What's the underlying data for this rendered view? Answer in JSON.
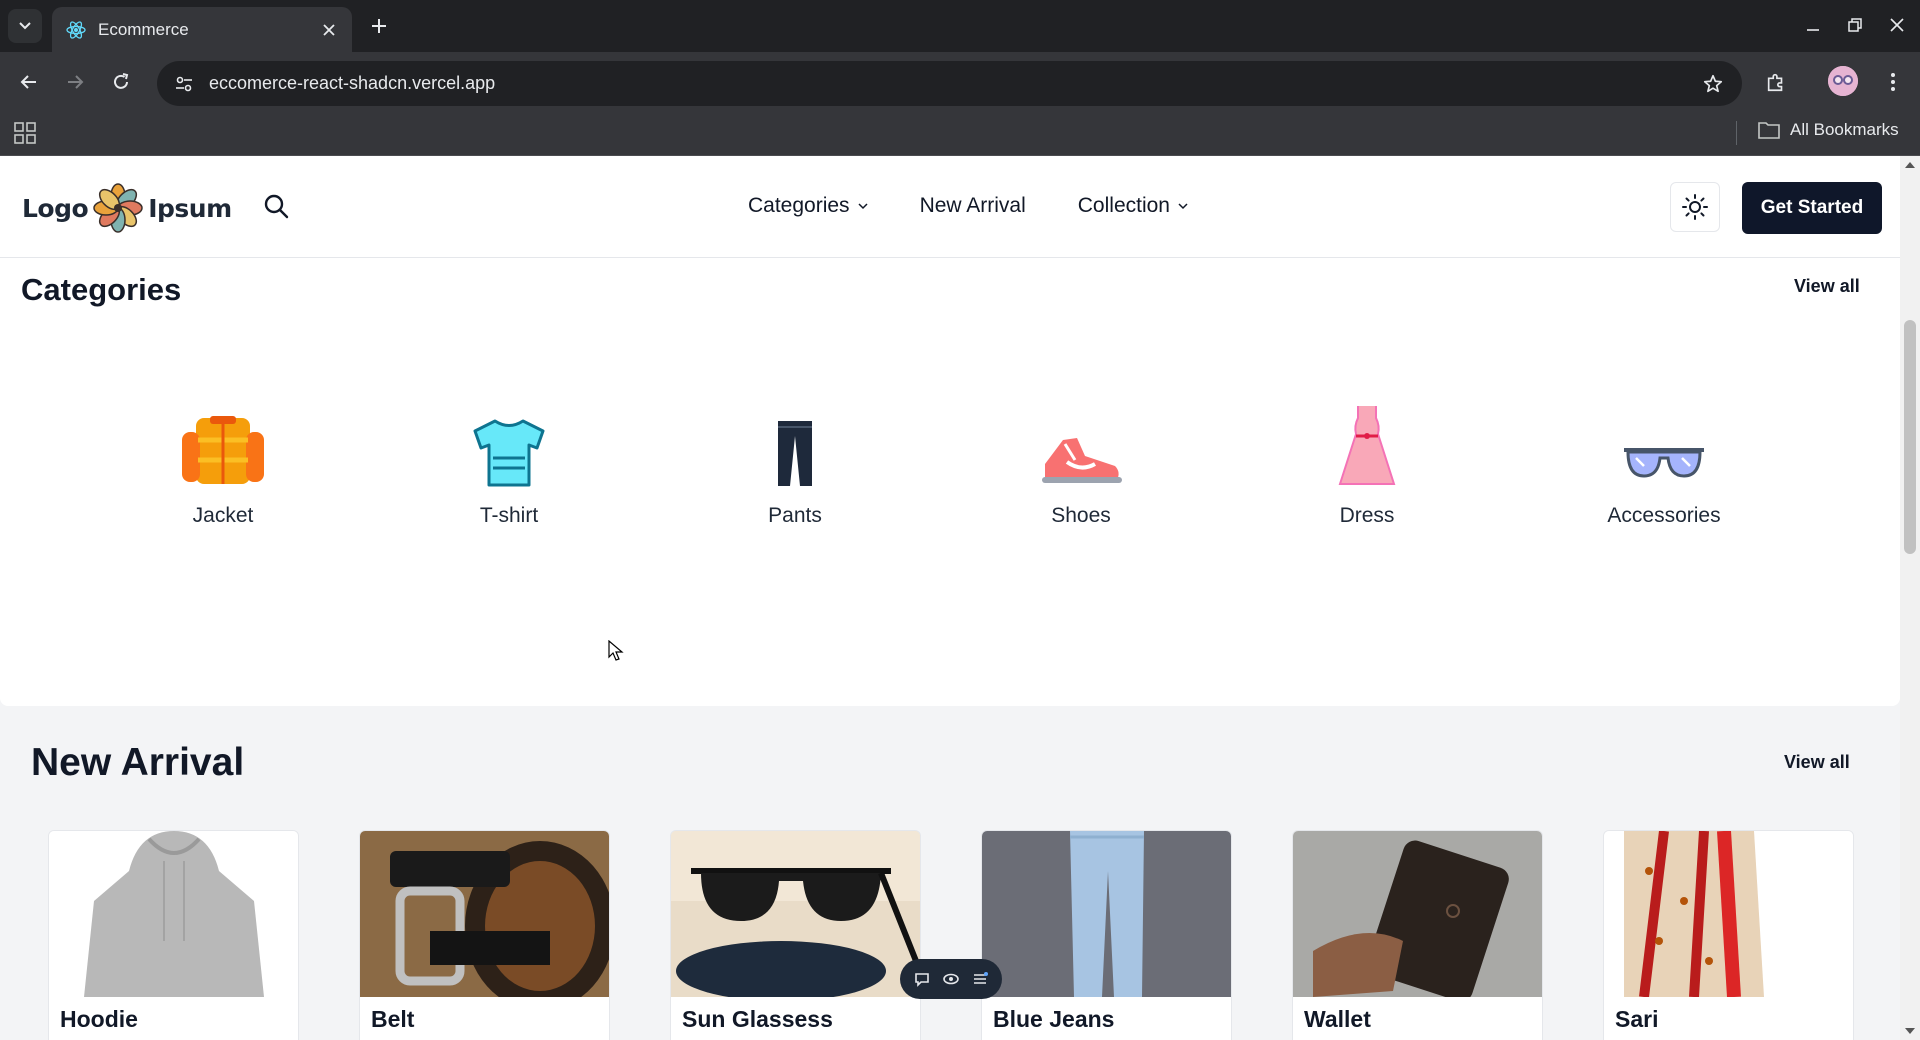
{
  "browser": {
    "tab_title": "Ecommerce",
    "url": "eccomerce-react-shadcn.vercel.app",
    "bookmarks_label": "All Bookmarks"
  },
  "header": {
    "logo_left": "Logo",
    "logo_right": "Ipsum",
    "nav": [
      {
        "label": "Categories",
        "has_dropdown": true
      },
      {
        "label": "New Arrival",
        "has_dropdown": false
      },
      {
        "label": "Collection",
        "has_dropdown": true
      }
    ],
    "cta_label": "Get Started",
    "theme_icon": "sun-icon"
  },
  "categories": {
    "title": "Categories",
    "view_all": "View all",
    "items": [
      {
        "label": "Jacket",
        "icon": "jacket-icon"
      },
      {
        "label": "T-shirt",
        "icon": "tshirt-icon"
      },
      {
        "label": "Pants",
        "icon": "pants-icon"
      },
      {
        "label": "Shoes",
        "icon": "shoes-icon"
      },
      {
        "label": "Dress",
        "icon": "dress-icon"
      },
      {
        "label": "Accessories",
        "icon": "glasses-icon"
      }
    ]
  },
  "new_arrival": {
    "title": "New Arrival",
    "view_all": "View all",
    "products": [
      {
        "name": "Hoodie"
      },
      {
        "name": "Belt"
      },
      {
        "name": "Sun Glassess"
      },
      {
        "name": "Blue Jeans"
      },
      {
        "name": "Wallet"
      },
      {
        "name": "Sari"
      }
    ]
  },
  "colors": {
    "primary_button": "#0f172a",
    "page_bg": "#f3f4f6",
    "browser_chrome": "#35363a"
  }
}
